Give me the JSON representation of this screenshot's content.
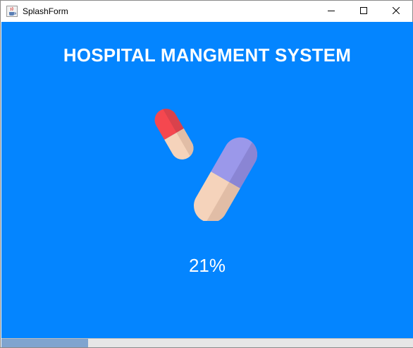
{
  "window": {
    "title": "SplashForm",
    "app_icon": "java-cup-icon",
    "controls": {
      "minimize_icon": "minimize-icon",
      "maximize_icon": "maximize-icon",
      "close_icon": "close-icon"
    }
  },
  "splash": {
    "heading": "HOSPITAL MANGMENT SYSTEM",
    "illustration": "pills-icon",
    "background_color": "#0485ff",
    "progress_text": "21%",
    "progress_value": 0.21
  }
}
